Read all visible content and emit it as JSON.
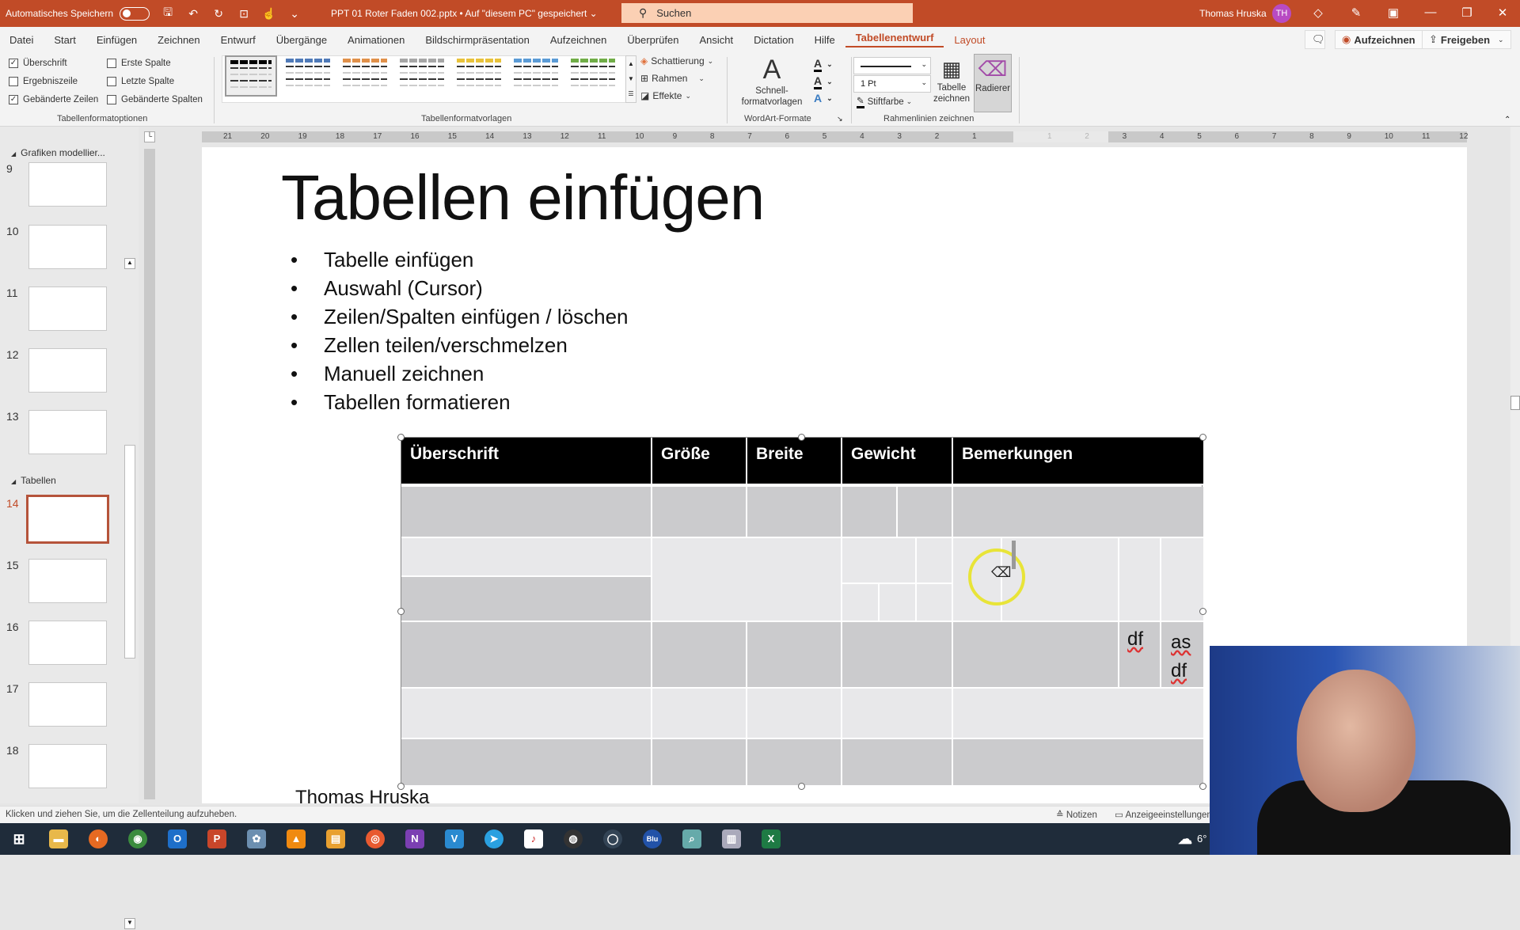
{
  "titlebar": {
    "autosave_label": "Automatisches Speichern",
    "document_title": "PPT 01 Roter Faden 002.pptx  •  Auf \"diesem PC\" gespeichert ⌄",
    "search_placeholder": "Suchen",
    "user_name": "Thomas Hruska",
    "user_initials": "TH"
  },
  "menu": {
    "items": [
      "Datei",
      "Start",
      "Einfügen",
      "Zeichnen",
      "Entwurf",
      "Übergänge",
      "Animationen",
      "Bildschirmpräsentation",
      "Aufzeichnen",
      "Überprüfen",
      "Ansicht",
      "Dictation",
      "Hilfe",
      "Tabellenentwurf",
      "Layout"
    ],
    "active": "Tabellenentwurf",
    "record_button": "Aufzeichnen",
    "share_button": "Freigeben"
  },
  "ribbon": {
    "options_group": {
      "label": "Tabellenformatoptionen",
      "checkboxes": [
        {
          "label": "Überschrift",
          "checked": true
        },
        {
          "label": "Ergebniszeile",
          "checked": false
        },
        {
          "label": "Gebänderte Zeilen",
          "checked": true
        },
        {
          "label": "Erste Spalte",
          "checked": false
        },
        {
          "label": "Letzte Spalte",
          "checked": false
        },
        {
          "label": "Gebänderte Spalten",
          "checked": false
        }
      ]
    },
    "styles_group": {
      "label": "Tabellenformatvorlagen",
      "style_colors": [
        "#000000",
        "#4f7ab8",
        "#e0904a",
        "#a6a6a6",
        "#e8c23a",
        "#5b9bd5",
        "#70ad47"
      ],
      "shading": "Schattierung",
      "borders": "Rahmen",
      "effects": "Effekte"
    },
    "wordart_group": {
      "label": "WordArt-Formate",
      "quick_styles": "Schnell-\nformatvorlagen"
    },
    "draw_group": {
      "label": "Rahmenlinien zeichnen",
      "pen_weight": "1 Pt",
      "pen_color": "Stiftfarbe",
      "draw_table": "Tabelle zeichnen",
      "eraser": "Radierer"
    }
  },
  "thumbnails": {
    "sections": [
      "Grafiken modellier...",
      "Tabellen"
    ],
    "slides": [
      "9",
      "10",
      "11",
      "12",
      "13",
      "14",
      "15",
      "16",
      "17",
      "18"
    ],
    "selected": "14"
  },
  "ruler": {
    "left_ticks": [
      "21",
      "20",
      "19",
      "18",
      "17",
      "16",
      "15",
      "14",
      "13",
      "12",
      "11",
      "10",
      "9",
      "8",
      "7",
      "6",
      "5",
      "4",
      "3",
      "2",
      "1"
    ],
    "right_ticks": [
      "1",
      "2",
      "3",
      "4",
      "5",
      "6",
      "7",
      "8",
      "9",
      "10",
      "11",
      "12"
    ]
  },
  "slide": {
    "title": "Tabellen einfügen",
    "bullets": [
      "Tabelle einfügen",
      "Auswahl (Cursor)",
      "Zeilen/Spalten einfügen / löschen",
      "Zellen teilen/verschmelzen",
      "Manuell zeichnen",
      "Tabellen formatieren"
    ],
    "footer": "Thomas Hruska",
    "table": {
      "headers": [
        "Überschrift",
        "Größe",
        "Breite",
        "Gewicht",
        "Bemerkungen"
      ],
      "cell_texts": [
        "df",
        "as\ndf"
      ]
    }
  },
  "status": {
    "hint": "Klicken und ziehen Sie, um die Zellenteilung aufzuheben.",
    "notes": "Notizen",
    "view_settings": "Anzeigeeinstellungen"
  },
  "taskbar": {
    "weather": "6°"
  }
}
